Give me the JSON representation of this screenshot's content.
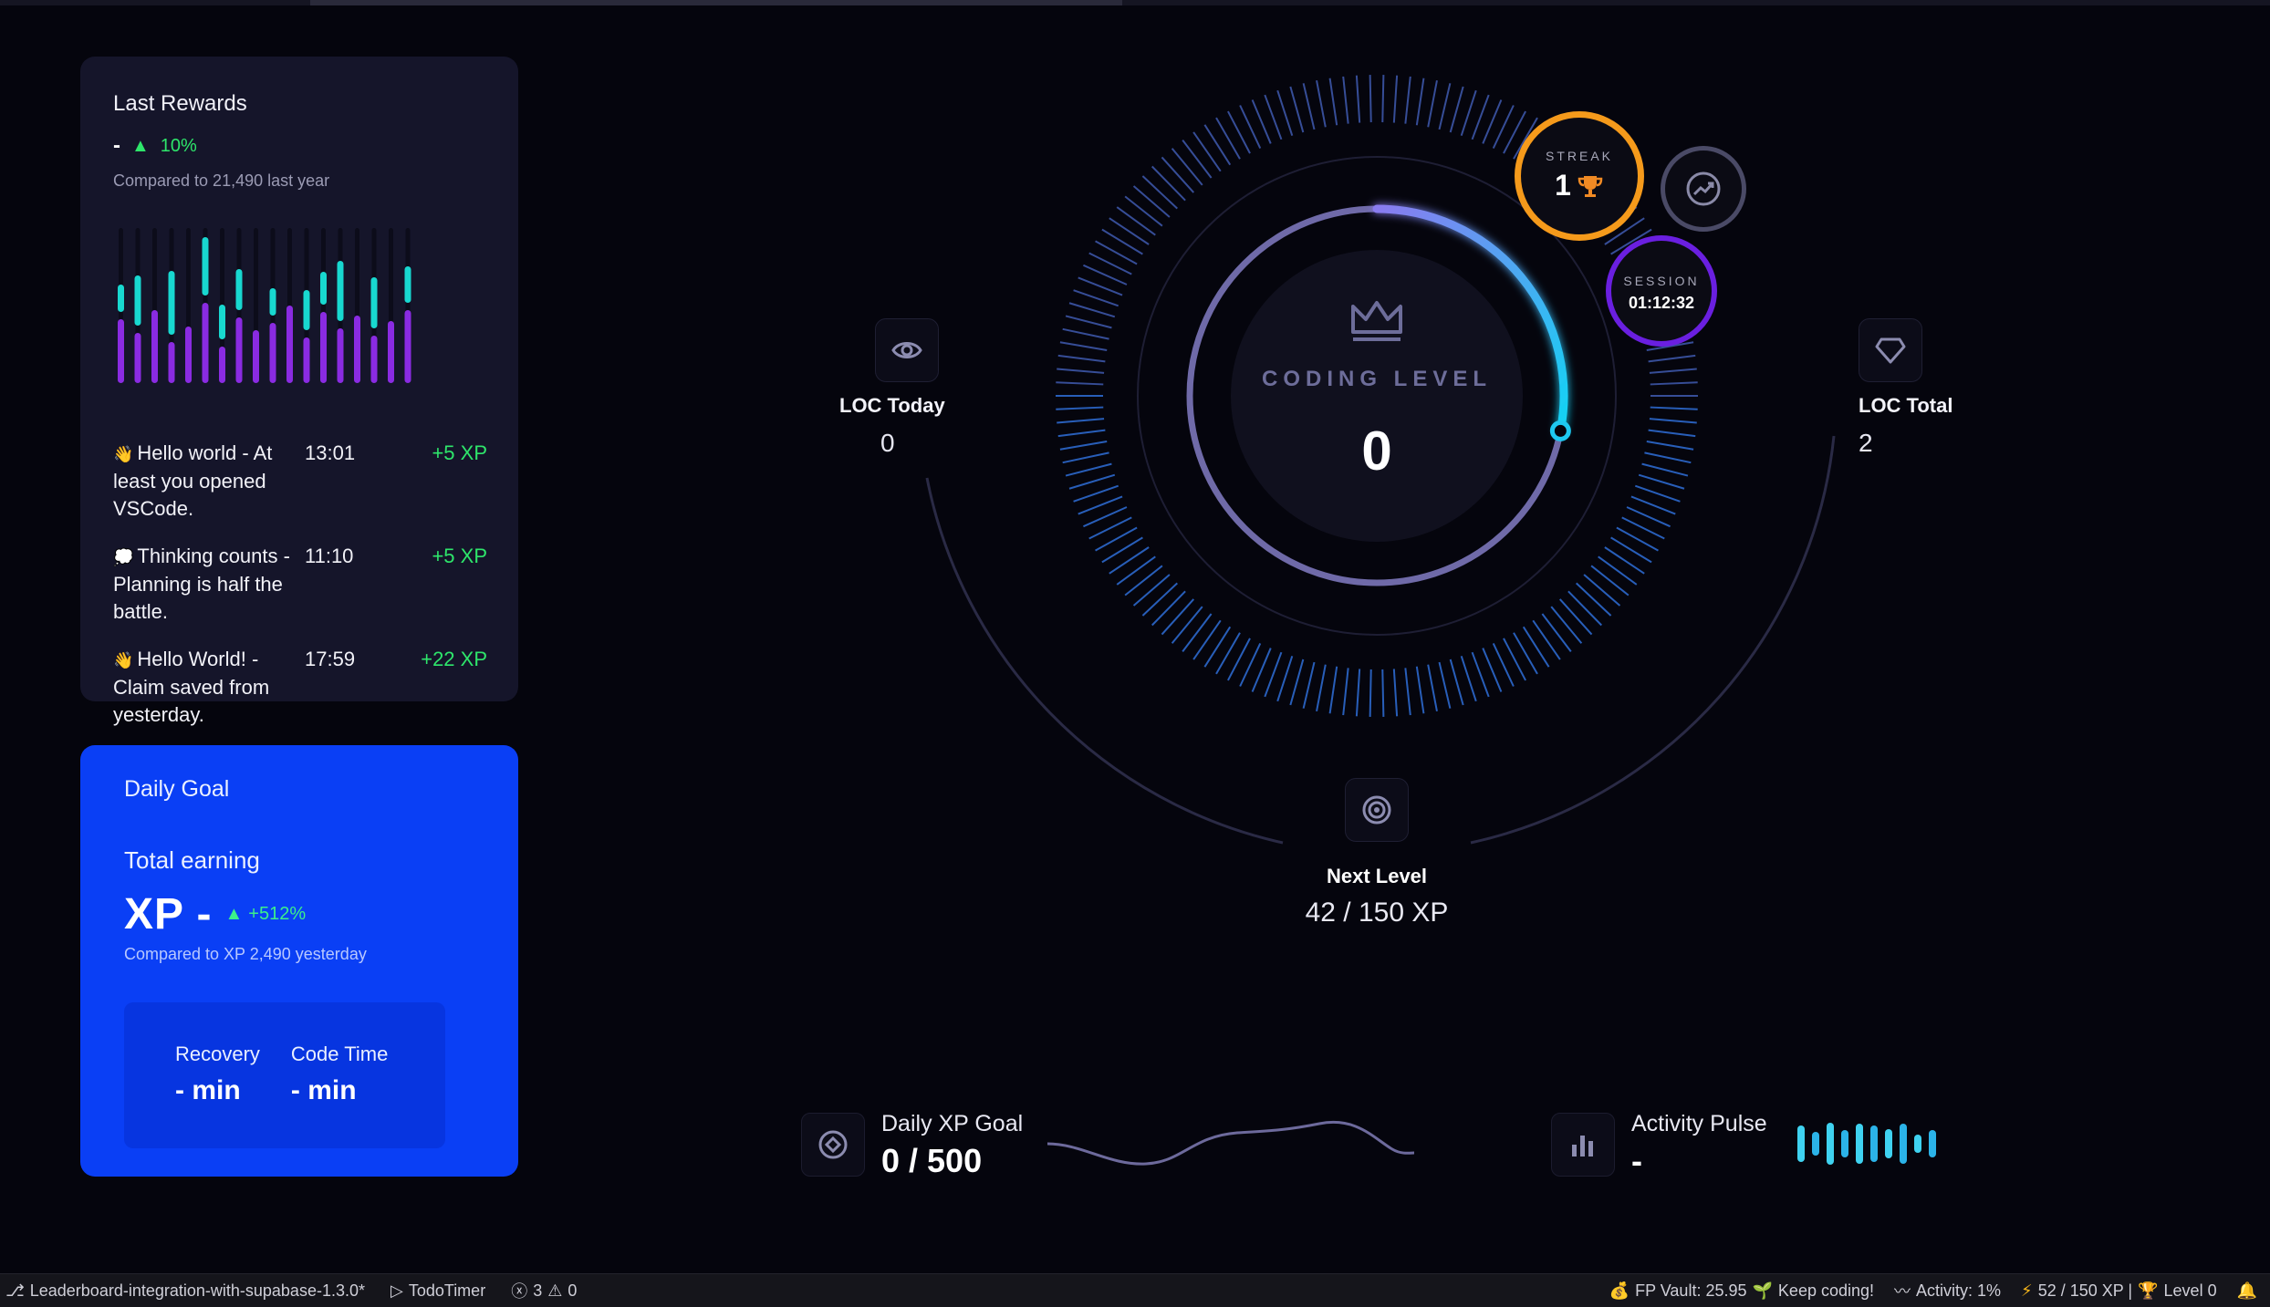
{
  "rewards": {
    "title": "Last Rewards",
    "value": "-",
    "change": "10%",
    "compare": "Compared to 21,490 last year",
    "items": [
      {
        "emoji": "👋",
        "text": "Hello world - At least you opened VSCode.",
        "time": "13:01",
        "xp": "+5 XP"
      },
      {
        "emoji": "💭",
        "text": "Thinking counts - Planning is half the battle.",
        "time": "11:10",
        "xp": "+5 XP"
      },
      {
        "emoji": "👋",
        "text": "Hello World! - Claim saved from yesterday.",
        "time": "17:59",
        "xp": "+22 XP"
      }
    ]
  },
  "daily_goal": {
    "title": "Daily Goal",
    "subtitle": "Total earning",
    "xp_value": "XP -",
    "change": "+512%",
    "compare": "Compared to XP 2,490 yesterday",
    "recovery_label": "Recovery",
    "recovery_value": "- min",
    "code_time_label": "Code Time",
    "code_time_value": "- min"
  },
  "dial": {
    "label": "CODING LEVEL",
    "value": "0",
    "progress": 0.28,
    "streak_label": "STREAK",
    "streak_value": "1",
    "session_label": "SESSION",
    "session_value": "01:12:32",
    "loc_today_label": "LOC Today",
    "loc_today_value": "0",
    "loc_total_label": "LOC Total",
    "loc_total_value": "2",
    "next_level_label": "Next Level",
    "next_level_value": "42 / 150 XP"
  },
  "metrics": {
    "daily_xp_label": "Daily XP Goal",
    "daily_xp_value": "0 / 500",
    "activity_label": "Activity Pulse",
    "activity_value": "-"
  },
  "statusbar": {
    "branch": "Leaderboard-integration-with-supabase-1.3.0*",
    "timer": "TodoTimer",
    "errors": "3",
    "warnings": "0",
    "vault": "FP Vault: 25.95",
    "keep": "Keep coding!",
    "activity": "Activity: 1%",
    "xp": "52 / 150 XP |",
    "level": "Level 0"
  },
  "colors": {
    "background": "#05050d",
    "card": "#15152a",
    "goal_card": "#0a3ff5",
    "accent_cyan": "#1ec8f0",
    "accent_green": "#2ee66b",
    "streak": "#f59a1b",
    "session": "#6a1fe0"
  }
}
